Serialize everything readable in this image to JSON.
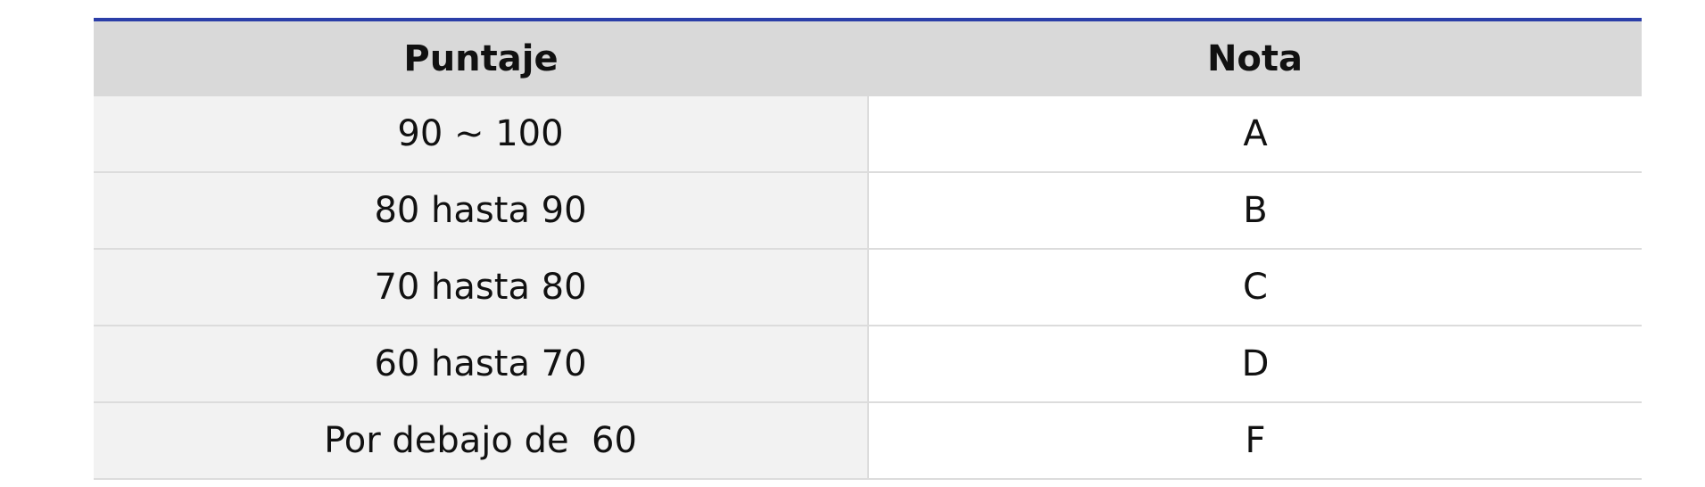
{
  "table": {
    "headers": {
      "score": "Puntaje",
      "grade": "Nota"
    },
    "rows": [
      {
        "score": "90 ~ 100",
        "grade": "A"
      },
      {
        "score": "80 hasta 90",
        "grade": "B"
      },
      {
        "score": "70 hasta 80",
        "grade": "C"
      },
      {
        "score": "60 hasta 70",
        "grade": "D"
      },
      {
        "score": "Por debajo de  60",
        "grade": "F"
      }
    ]
  },
  "colors": {
    "header_border": "#2b3ea8",
    "header_bg": "#d9d9d9",
    "score_cell_bg": "#f2f2f2",
    "grade_cell_bg": "#ffffff"
  }
}
